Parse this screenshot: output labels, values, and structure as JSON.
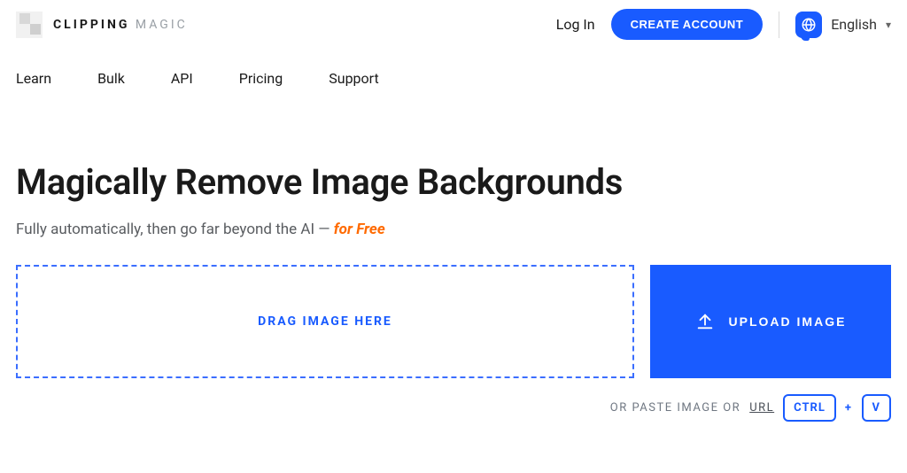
{
  "brand": {
    "bold": "CLIPPING",
    "light": "MAGIC"
  },
  "header": {
    "login": "Log In",
    "create_account": "CREATE ACCOUNT",
    "language": "English"
  },
  "nav": {
    "items": [
      "Learn",
      "Bulk",
      "API",
      "Pricing",
      "Support"
    ]
  },
  "hero": {
    "title": "Magically Remove Image Backgrounds",
    "subhead_prefix": "Fully automatically, then go far beyond the AI — ",
    "subhead_emphasis": "for Free"
  },
  "uploader": {
    "drag_label": "DRAG IMAGE HERE",
    "upload_label": "UPLOAD IMAGE"
  },
  "paste": {
    "prefix": "OR PASTE IMAGE OR",
    "url_label": "URL",
    "key1": "CTRL",
    "plus": "+",
    "key2": "V"
  }
}
